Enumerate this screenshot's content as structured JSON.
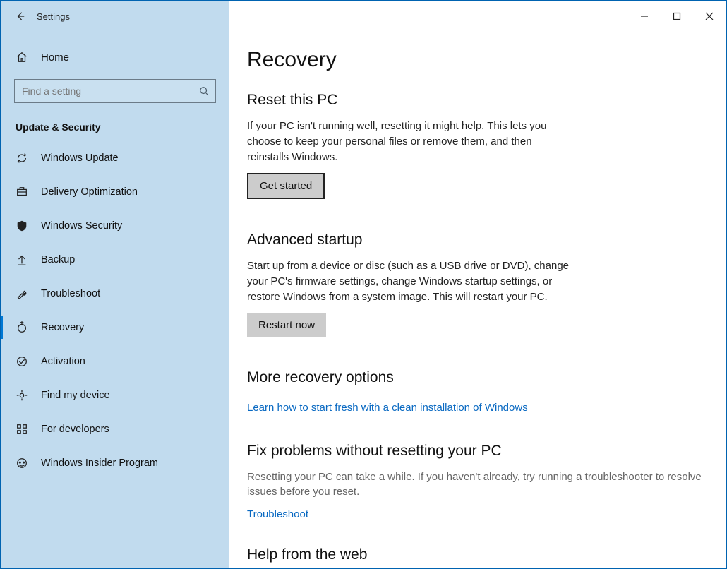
{
  "window": {
    "title": "Settings"
  },
  "sidebar": {
    "home_label": "Home",
    "search_placeholder": "Find a setting",
    "section_label": "Update & Security",
    "items": [
      {
        "label": "Windows Update",
        "icon": "refresh"
      },
      {
        "label": "Delivery Optimization",
        "icon": "delivery"
      },
      {
        "label": "Windows Security",
        "icon": "shield"
      },
      {
        "label": "Backup",
        "icon": "backup"
      },
      {
        "label": "Troubleshoot",
        "icon": "wrench"
      },
      {
        "label": "Recovery",
        "icon": "recovery",
        "active": true
      },
      {
        "label": "Activation",
        "icon": "check-circle"
      },
      {
        "label": "Find my device",
        "icon": "locate"
      },
      {
        "label": "For developers",
        "icon": "dev"
      },
      {
        "label": "Windows Insider Program",
        "icon": "insider"
      }
    ]
  },
  "main": {
    "page_title": "Recovery",
    "sections": {
      "reset": {
        "title": "Reset this PC",
        "body": "If your PC isn't running well, resetting it might help. This lets you choose to keep your personal files or remove them, and then reinstalls Windows.",
        "button": "Get started"
      },
      "advanced": {
        "title": "Advanced startup",
        "body": "Start up from a device or disc (such as a USB drive or DVD), change your PC's firmware settings, change Windows startup settings, or restore Windows from a system image. This will restart your PC.",
        "button": "Restart now"
      },
      "more": {
        "title": "More recovery options",
        "link": "Learn how to start fresh with a clean installation of Windows"
      },
      "fix": {
        "title": "Fix problems without resetting your PC",
        "body": "Resetting your PC can take a while. If you haven't already, try running a troubleshooter to resolve issues before you reset.",
        "link": "Troubleshoot"
      },
      "help": {
        "title": "Help from the web"
      }
    }
  }
}
